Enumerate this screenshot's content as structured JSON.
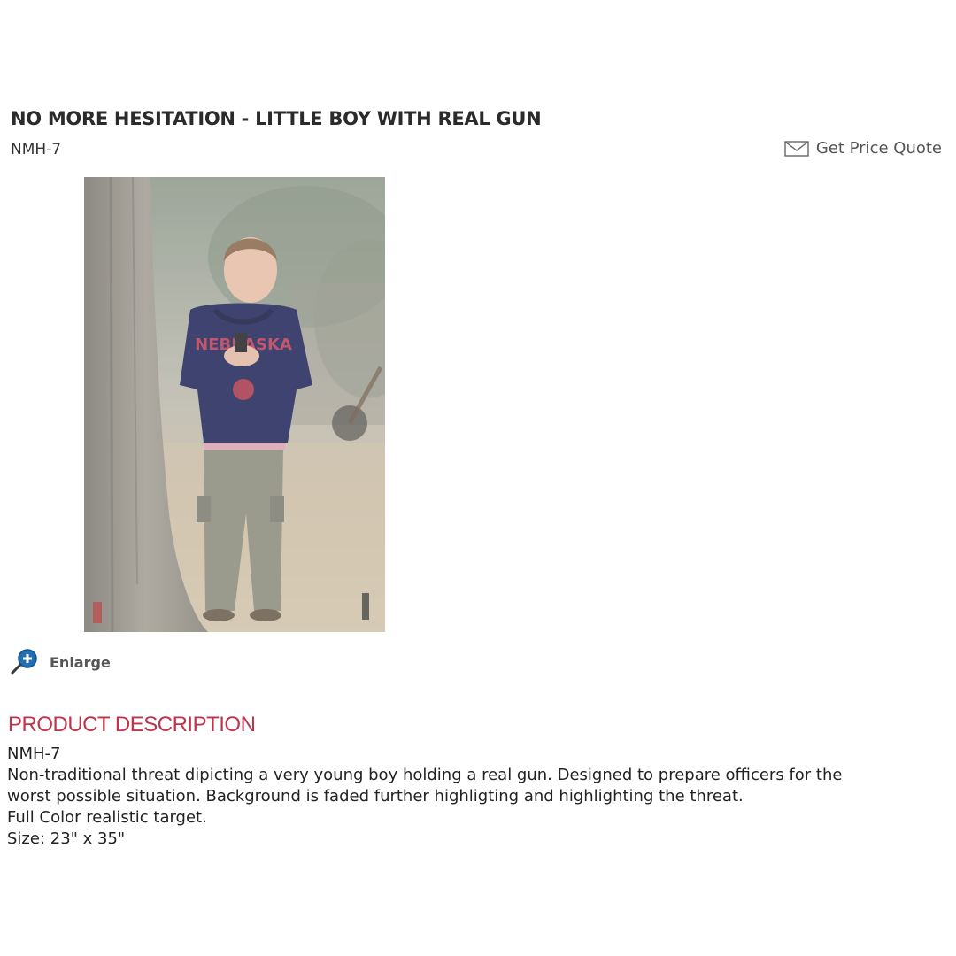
{
  "product": {
    "title": "NO MORE HESITATION - LITTLE BOY WITH REAL GUN",
    "sku": "NMH-7",
    "quote_label": "Get Price Quote",
    "enlarge_label": "Enlarge"
  },
  "description": {
    "heading": "PRODUCT DESCRIPTION",
    "lines": [
      "NMH-7",
      "Non-traditional threat dipicting a very young boy holding a real gun. Designed to prepare officers for the",
      "worst possible situation. Background is faded further highligting and highlighting the threat.",
      "Full Color realistic target.",
      "Size: 23\" x 35\""
    ]
  },
  "icons": {
    "quote": "envelope-icon",
    "enlarge": "magnifier-plus-icon"
  },
  "colors": {
    "heading_accent": "#c0334b",
    "text": "#222222",
    "link_gray": "#555555",
    "icon_blue": "#1f6fb5"
  }
}
